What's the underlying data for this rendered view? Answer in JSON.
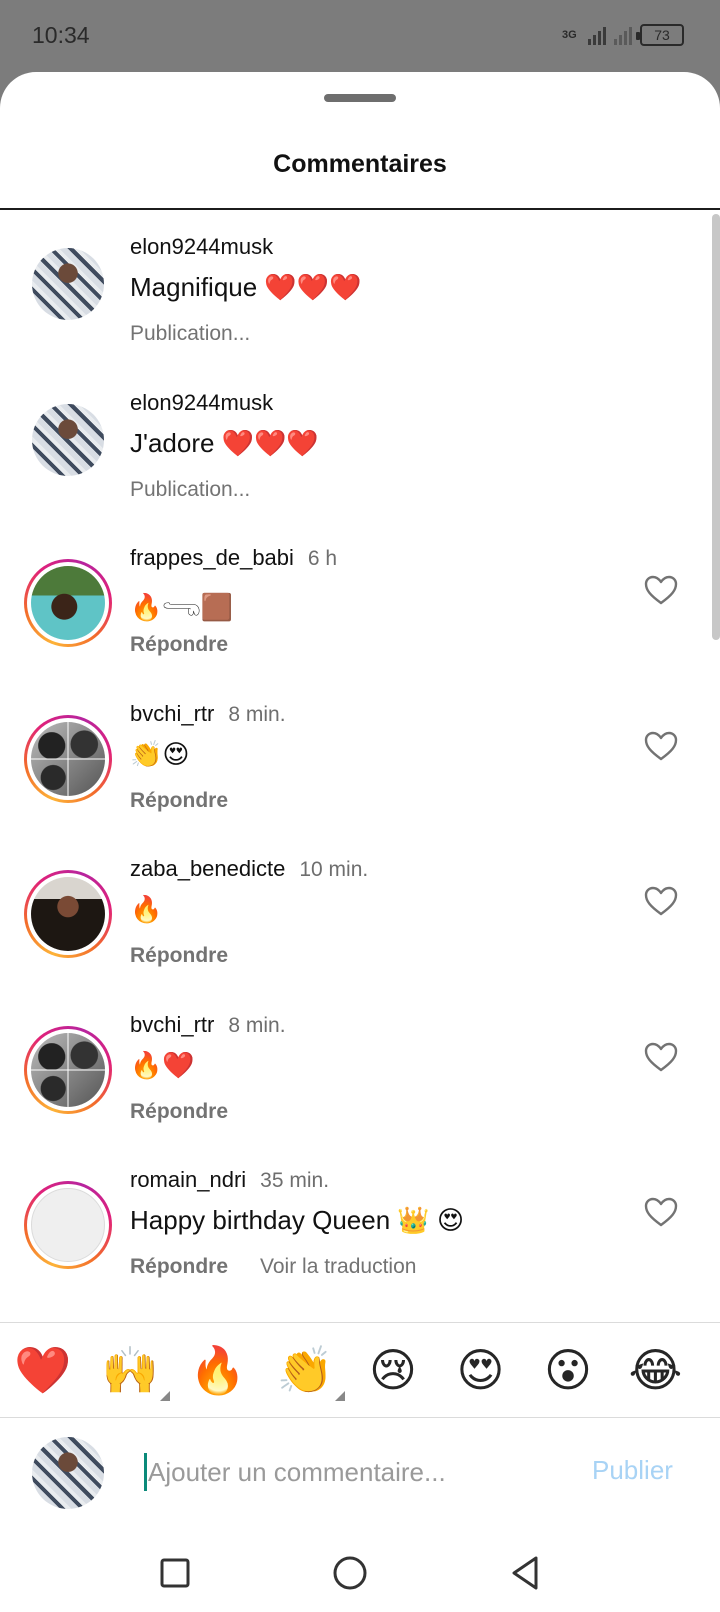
{
  "status_bar": {
    "time": "10:34",
    "network": "3G",
    "battery": "73"
  },
  "sheet": {
    "title": "Commentaires"
  },
  "comments": [
    {
      "username": "elon9244musk",
      "time": "",
      "text": "Magnifique ❤️❤️❤️",
      "actions": [
        "Publication..."
      ],
      "avatar": "user-avatar",
      "liked": false,
      "ring": false
    },
    {
      "username": "elon9244musk",
      "time": "",
      "text": "J'adore ❤️❤️❤️",
      "actions": [
        "Publication..."
      ],
      "avatar": "user-avatar",
      "liked": false,
      "ring": false
    },
    {
      "username": "frappes_de_babi",
      "time": "6 h",
      "text": "🔥𓂸🟫",
      "actions": [
        "Répondre"
      ],
      "avatar": "pool-avatar",
      "liked": false,
      "ring": true
    },
    {
      "username": "bvchi_rtr",
      "time": "8 min.",
      "text": "👏😍",
      "actions": [
        "Répondre"
      ],
      "avatar": "bw-collage-avatar",
      "liked": false,
      "ring": true
    },
    {
      "username": "zaba_benedicte",
      "time": "10 min.",
      "text": "🔥",
      "actions": [
        "Répondre"
      ],
      "avatar": "woman-avatar",
      "liked": false,
      "ring": true
    },
    {
      "username": "bvchi_rtr",
      "time": "8 min.",
      "text": "🔥❤️",
      "actions": [
        "Répondre"
      ],
      "avatar": "bw-collage-avatar",
      "liked": false,
      "ring": true
    },
    {
      "username": "romain_ndri",
      "time": "35 min.",
      "text": "Happy birthday Queen 👑 😍",
      "actions": [
        "Répondre",
        "Voir la traduction"
      ],
      "avatar": "empty-avatar",
      "liked": false,
      "ring": true
    }
  ],
  "reactions": [
    "❤️",
    "🙌",
    "🔥",
    "👏",
    "😢",
    "😍",
    "😮",
    "😂"
  ],
  "composer": {
    "placeholder": "Ajouter un commentaire...",
    "publish_label": "Publier"
  },
  "colors": {
    "publish_disabled": "#a8d3f5",
    "story_ring": "#e0217a",
    "caret": "#0b8a7a"
  }
}
